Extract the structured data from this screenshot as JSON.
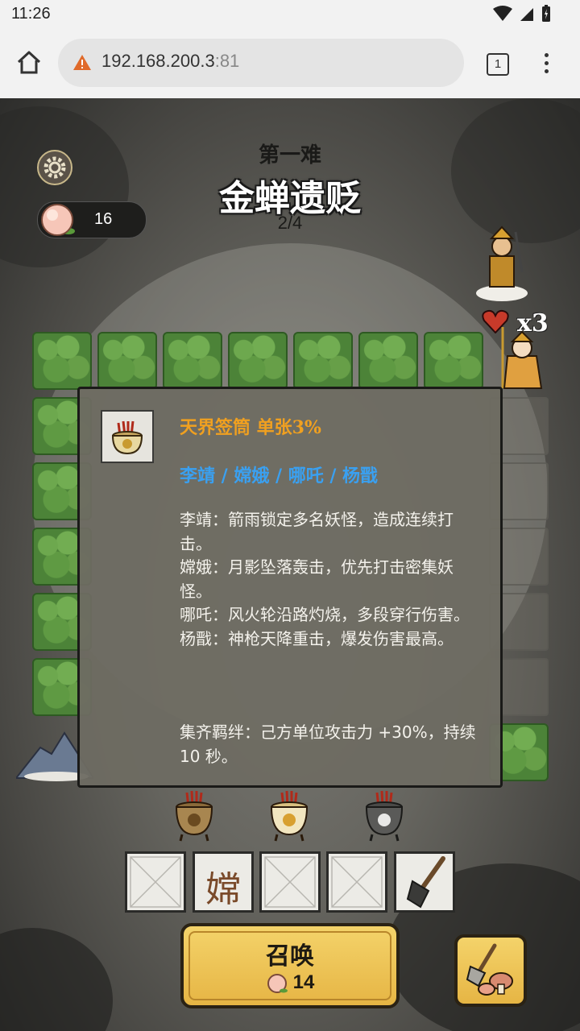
{
  "status_bar": {
    "time": "11:26"
  },
  "browser": {
    "url_host": "192.168.200.3",
    "url_port": ":81",
    "tab_count": "1"
  },
  "game": {
    "peach_count": "16",
    "stage_subtitle": "第一难",
    "stage_title": "金蝉遗贬",
    "stage_progress": "2/4",
    "lives": "x3",
    "info_panel": {
      "title": "天界签筒 单张3%",
      "heroes": "李靖 / 嫦娥 / 哪吒 / 杨戬",
      "descriptions": [
        "李靖：箭雨锁定多名妖怪，造成连续打击。",
        "嫦娥：月影坠落轰击，优先打击密集妖怪。",
        "哪吒：风火轮沿路灼烧，多段穿行伤害。",
        "杨戬：神枪天降重击，爆发伤害最高。"
      ],
      "bond": "集齐羁绊：己方单位攻击力 +30%，持续 10 秒。"
    },
    "hand_slots": [
      {
        "label": ""
      },
      {
        "label": "嫦"
      },
      {
        "label": ""
      },
      {
        "label": ""
      },
      {
        "label": ""
      }
    ],
    "summon": {
      "label": "召唤",
      "cost": "14"
    },
    "colors": {
      "title_orange": "#f0a020",
      "hero_blue": "#3aa0f0",
      "button_gold": "#e6b544"
    }
  }
}
